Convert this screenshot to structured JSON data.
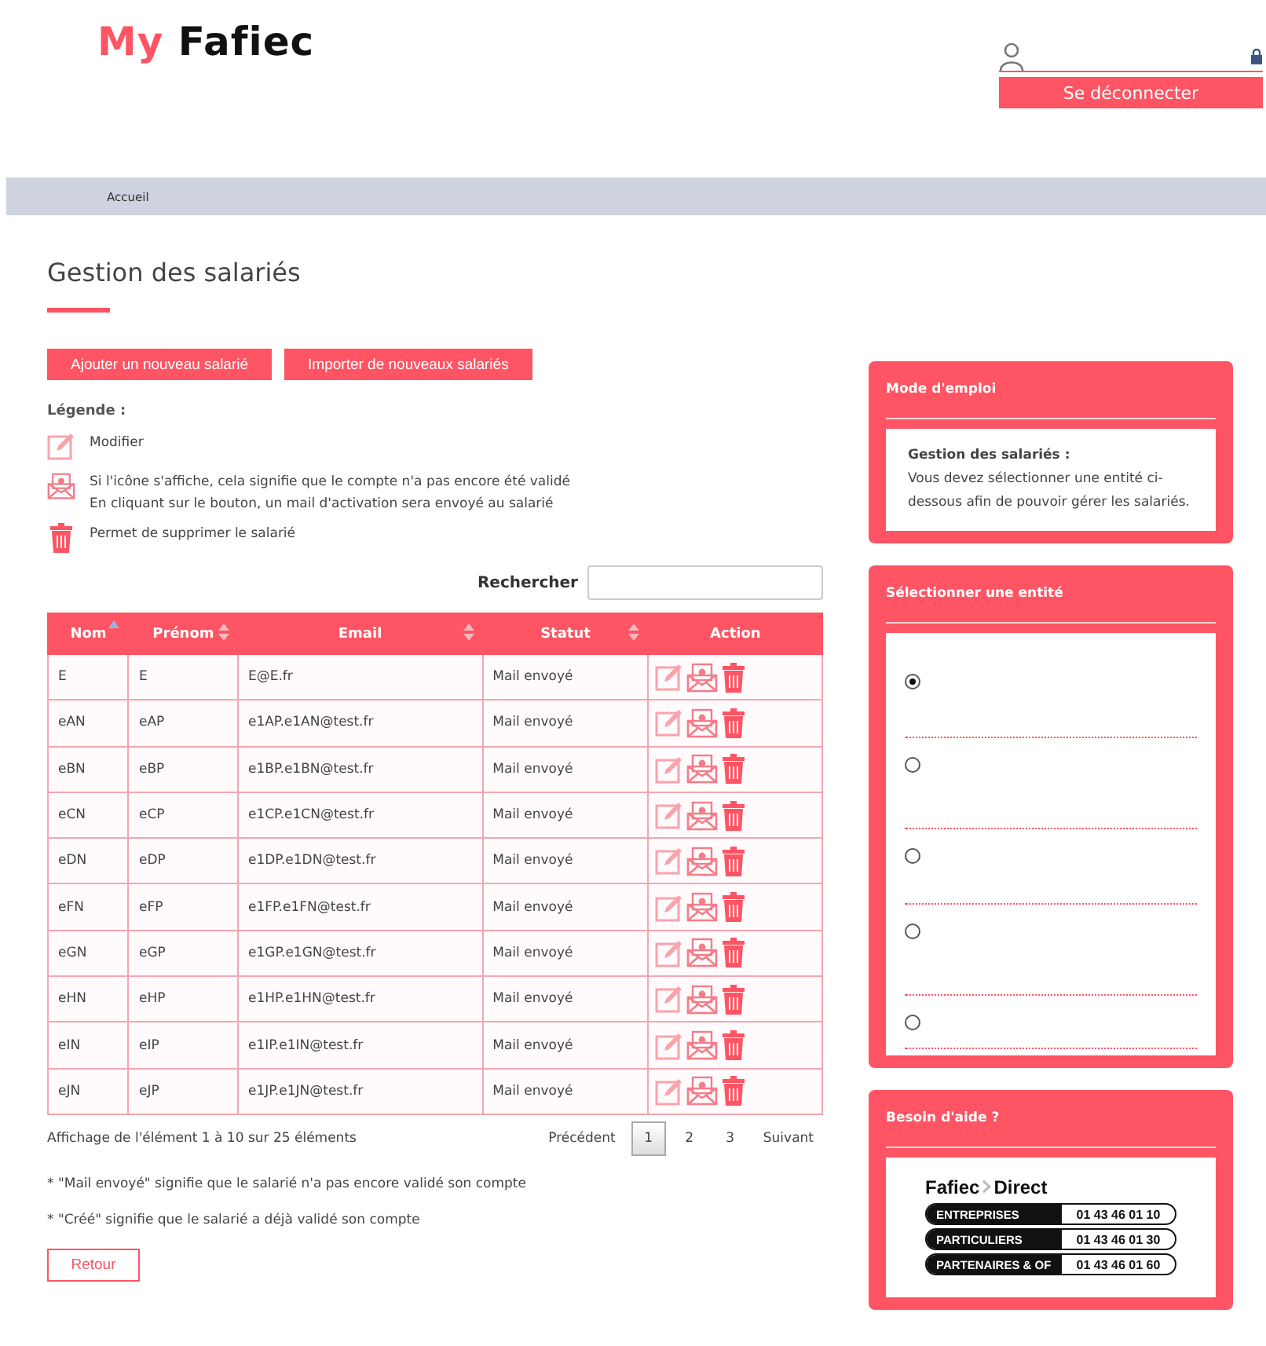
{
  "header": {
    "logo": {
      "part1": "My",
      "part2": "Fafiec"
    },
    "logout": "Se déconnecter"
  },
  "breadcrumb": [
    "Accueil"
  ],
  "title": "Gestion des salariés",
  "actions": [
    "Ajouter un nouveau salarié",
    "Importer de nouveaux salariés"
  ],
  "legend": {
    "title": "Légende :",
    "items": [
      {
        "kind": "edit",
        "lines": [
          "Modifier"
        ]
      },
      {
        "kind": "mail",
        "lines": [
          "Si l'icône s'affiche, cela signifie que le compte n'a pas encore été validé",
          "En cliquant sur le bouton, un mail d'activation sera envoyé au salarié"
        ]
      },
      {
        "kind": "delete",
        "lines": [
          "Permet de supprimer le salarié"
        ]
      }
    ]
  },
  "search": {
    "label": "Rechercher"
  },
  "table": {
    "columns": [
      {
        "label": "Nom",
        "sortable": true,
        "sorted": true
      },
      {
        "label": "Prénom",
        "sortable": true,
        "sorted": false
      },
      {
        "label": "Email",
        "sortable": true,
        "sorted": false
      },
      {
        "label": "Statut",
        "sortable": true,
        "sorted": false
      },
      {
        "label": "Action",
        "sortable": false,
        "sorted": false
      }
    ],
    "rows": [
      [
        "E",
        "E",
        "E@E.fr",
        "Mail envoyé"
      ],
      [
        "eAN",
        "eAP",
        "e1AP.e1AN@test.fr",
        "Mail envoyé"
      ],
      [
        "eBN",
        "eBP",
        "e1BP.e1BN@test.fr",
        "Mail envoyé"
      ],
      [
        "eCN",
        "eCP",
        "e1CP.e1CN@test.fr",
        "Mail envoyé"
      ],
      [
        "eDN",
        "eDP",
        "e1DP.e1DN@test.fr",
        "Mail envoyé"
      ],
      [
        "eFN",
        "eFP",
        "e1FP.e1FN@test.fr",
        "Mail envoyé"
      ],
      [
        "eGN",
        "eGP",
        "e1GP.e1GN@test.fr",
        "Mail envoyé"
      ],
      [
        "eHN",
        "eHP",
        "e1HP.e1HN@test.fr",
        "Mail envoyé"
      ],
      [
        "eIN",
        "eIP",
        "e1IP.e1IN@test.fr",
        "Mail envoyé"
      ],
      [
        "eJN",
        "eJP",
        "e1JP.e1JN@test.fr",
        "Mail envoyé"
      ]
    ]
  },
  "info": "Affichage de l'élément 1 à 10 sur 25 éléments",
  "pagination": {
    "previous": "Précédent",
    "next": "Suivant",
    "pages": [
      {
        "label": "1",
        "selected": true
      },
      {
        "label": "2",
        "selected": false
      },
      {
        "label": "3",
        "selected": false
      }
    ]
  },
  "notes": [
    "* \"Mail envoyé\" signifie que le salarié n'a pas encore validé son compte",
    "* \"Créé\" signifie que le salarié a déjà validé son compte"
  ],
  "back": "Retour",
  "sidebar": {
    "help": {
      "title": "Mode d'emploi",
      "heading": "Gestion des salariés :",
      "text": "Vous devez sélectionner une entité ci-dessous afin de pouvoir gérer les salariés."
    },
    "entities": {
      "title": "Sélectionner une entité",
      "items": [
        {
          "selected": true
        },
        {
          "selected": false
        },
        {
          "selected": false
        },
        {
          "selected": false
        },
        {
          "selected": false
        }
      ]
    },
    "support": {
      "title": "Besoin d'aide ?",
      "brand": {
        "part1": "Fafiec",
        "part2": "Direct"
      },
      "lines": [
        {
          "label": "ENTREPRISES",
          "phone": "01 43 46 01 10"
        },
        {
          "label": "PARTICULIERS",
          "phone": "01 43 46 01 30"
        },
        {
          "label": "PARTENAIRES & OF",
          "phone": "01 43 46 01 60"
        }
      ]
    }
  }
}
